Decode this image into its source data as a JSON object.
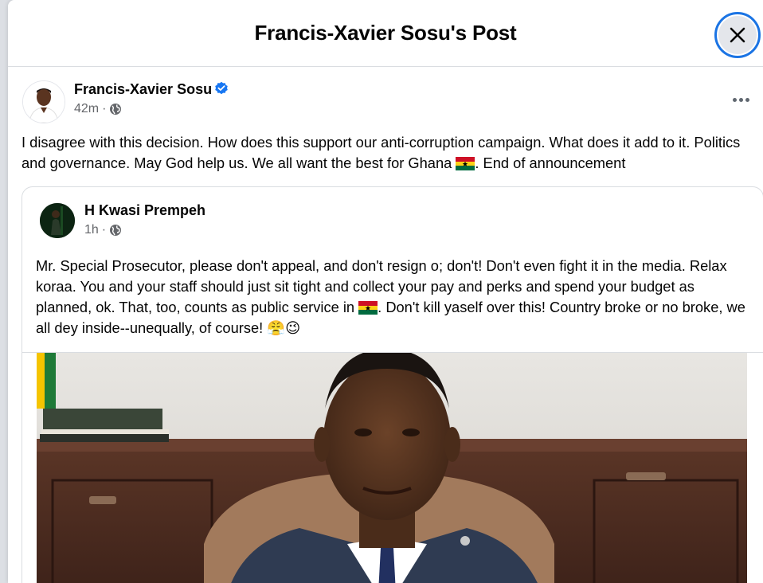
{
  "header": {
    "title": "Francis-Xavier Sosu's Post",
    "close_icon": "close-icon"
  },
  "post": {
    "author": "Francis-Xavier Sosu",
    "verified_icon": "verified-badge-icon",
    "time": "42m",
    "separator": "·",
    "privacy_icon": "globe-icon",
    "more_icon": "more-options-icon",
    "text_before_flag": "I disagree with this decision. How does this support our anti-corruption campaign. What does it add to it. Politics and governance. May God help us. We all want the best for Ghana",
    "text_after_flag": ". End of announcement"
  },
  "shared_post": {
    "author": "H Kwasi Prempeh",
    "time": "1h",
    "separator": "·",
    "privacy_icon": "globe-icon",
    "text_before_flag": "Mr. Special Prosecutor, please don't appeal, and don't resign o; don't!  Don't even fight it in the media. Relax koraa. You and your staff should just sit tight and collect your pay and perks and spend your budget as planned, ok. That, too, counts as public service in",
    "text_after_flag": ". Don't kill yaself over this! Country broke or no broke, we all dey inside--unequally, of course!",
    "emojis": "😤😉"
  },
  "colors": {
    "verified": "#1877f2",
    "close_ring": "#1b74e4",
    "meta_text": "#65676b",
    "flag_red": "#ce1126",
    "flag_gold": "#fcd116",
    "flag_green": "#006b3f"
  }
}
